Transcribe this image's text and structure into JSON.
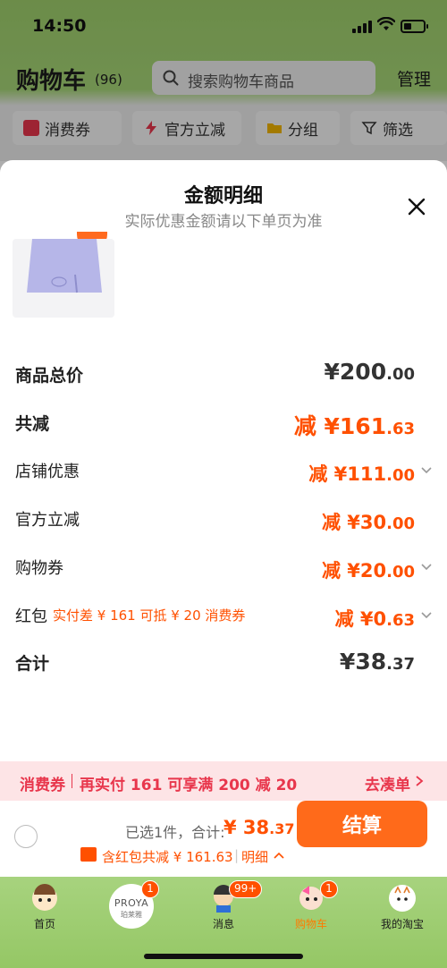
{
  "status_bar": {
    "time": "14:50"
  },
  "header": {
    "title": "购物车",
    "count": "(96)",
    "search_placeholder": "搜索购物车商品",
    "manage": "管理"
  },
  "filters": [
    {
      "label": "消费券",
      "icon": "coupon-icon"
    },
    {
      "label": "官方立减",
      "icon": "lightning-icon"
    },
    {
      "label": "分组",
      "icon": "folder-icon"
    },
    {
      "label": "筛选",
      "icon": "filter-icon"
    }
  ],
  "sheet": {
    "title": "金额明细",
    "subtitle": "实际优惠金额请以下单页为准",
    "rows": {
      "total_label": "商品总价",
      "total_value_main": "¥200",
      "total_value_dec": ".00",
      "reduce_label": "共减",
      "reduce_value_main": "减 ¥161",
      "reduce_value_dec": ".63",
      "shop_label": "店铺优惠",
      "shop_value_main": "减 ¥111",
      "shop_value_dec": ".00",
      "official_label": "官方立减",
      "official_value_main": "减 ¥30",
      "official_value_dec": ".00",
      "coupon_label": "购物券",
      "coupon_value_main": "减 ¥20",
      "coupon_value_dec": ".00",
      "redpack_label": "红包",
      "redpack_note": "实付差 ¥ 161 可抵 ¥ 20 消费券",
      "redpack_value_main": "减 ¥0",
      "redpack_value_dec": ".63",
      "sum_label": "合计",
      "sum_value_main": "¥38",
      "sum_value_dec": ".37"
    }
  },
  "promo": {
    "tag": "消费券",
    "text": "再实付 161 可享满 200 减 20",
    "link": "去凑单"
  },
  "checkout": {
    "selected": "已选1件，合计:",
    "total_main": "¥ 38",
    "total_dec": ".37",
    "discount": "含红包共减 ¥ 161.63",
    "detail": "明细",
    "button": "结算"
  },
  "tabs": [
    {
      "label": "首页",
      "badge": ""
    },
    {
      "label": "",
      "badge": "1",
      "brand": "PROYA",
      "brand_sub": "珀莱雅"
    },
    {
      "label": "消息",
      "badge": "99+"
    },
    {
      "label": "购物车",
      "badge": "1"
    },
    {
      "label": "我的淘宝",
      "badge": ""
    }
  ],
  "colors": {
    "accent": "#ff5000",
    "button": "#ff6a1a",
    "promo_bg": "#fde4e6",
    "promo_text": "#e8364c",
    "header_green": "#a6d577"
  }
}
